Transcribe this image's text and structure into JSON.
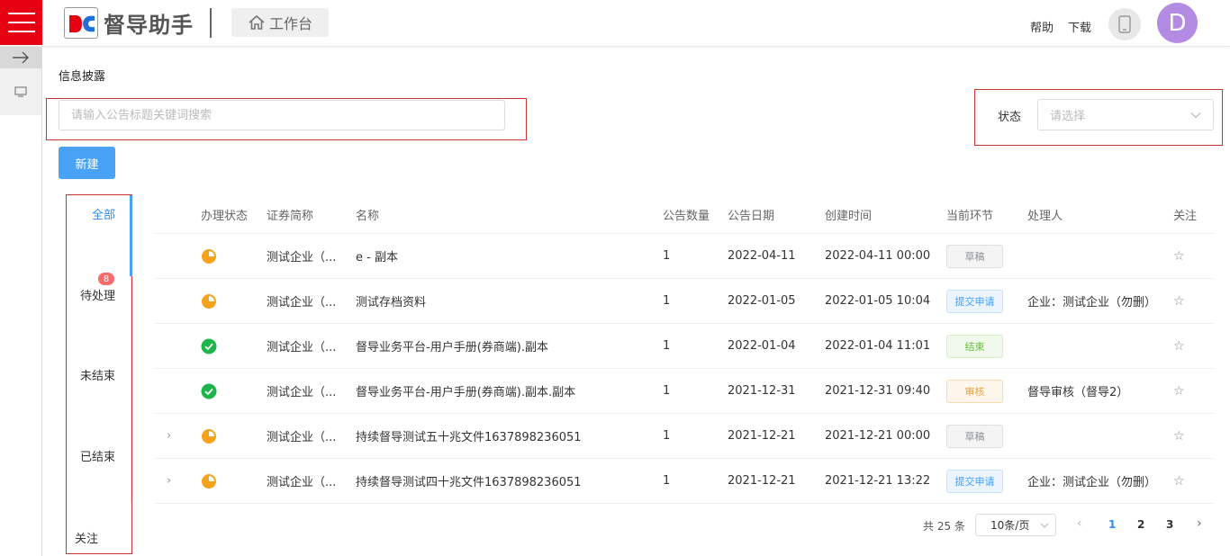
{
  "app": {
    "logo_text": "督导助手",
    "workbench_label": "工作台"
  },
  "header": {
    "help": "帮助",
    "download": "下载",
    "avatar_letter": "D"
  },
  "page": {
    "title": "信息披露"
  },
  "search": {
    "placeholder": "请输入公告标题关键词搜索",
    "value": ""
  },
  "status_filter": {
    "label": "状态",
    "placeholder": "请选择"
  },
  "actions": {
    "new_label": "新建"
  },
  "tabs": [
    {
      "label": "全部",
      "active": true
    },
    {
      "label": "待处理",
      "badge": "8"
    },
    {
      "label": "未结束"
    },
    {
      "label": "已结束"
    },
    {
      "label": "关注"
    }
  ],
  "table": {
    "columns": [
      "办理状态",
      "证券简称",
      "名称",
      "公告数量",
      "公告日期",
      "创建时间",
      "当前环节",
      "处理人",
      "关注"
    ],
    "rows": [
      {
        "status": "pending",
        "security": "测试企业（...",
        "name": "e - 副本",
        "count": "1",
        "date": "2022-04-11",
        "created": "2022-04-11 00:00",
        "node": "草稿",
        "node_type": "draft",
        "handler": "",
        "expandable": false
      },
      {
        "status": "pending",
        "security": "测试企业（...",
        "name": "测试存档资料",
        "count": "1",
        "date": "2022-01-05",
        "created": "2022-01-05 10:04",
        "node": "提交申请",
        "node_type": "submit",
        "handler": "企业：测试企业（勿删）",
        "expandable": false
      },
      {
        "status": "done",
        "security": "测试企业（...",
        "name": "督导业务平台-用户手册(券商端).副本",
        "count": "1",
        "date": "2022-01-04",
        "created": "2022-01-04 11:01",
        "node": "结束",
        "node_type": "done",
        "handler": "",
        "expandable": false
      },
      {
        "status": "done",
        "security": "测试企业（...",
        "name": "督导业务平台-用户手册(券商端).副本.副本",
        "count": "1",
        "date": "2021-12-31",
        "created": "2021-12-31 09:40",
        "node": "审核",
        "node_type": "review",
        "handler": "督导审核（督导2）",
        "expandable": false
      },
      {
        "status": "pending",
        "security": "测试企业（...",
        "name": "持续督导测试五十兆文件1637898236051",
        "count": "1",
        "date": "2021-12-21",
        "created": "2021-12-21 00:00",
        "node": "草稿",
        "node_type": "draft",
        "handler": "",
        "expandable": true
      },
      {
        "status": "pending",
        "security": "测试企业（...",
        "name": "持续督导测试四十兆文件1637898236051",
        "count": "1",
        "date": "2021-12-21",
        "created": "2021-12-21 13:22",
        "node": "提交申请",
        "node_type": "submit",
        "handler": "企业：测试企业（勿删）",
        "expandable": true
      }
    ]
  },
  "pagination": {
    "total": "共 25 条",
    "page_size": "10条/页",
    "pages": [
      "1",
      "2",
      "3"
    ],
    "current": "1"
  },
  "colors": {
    "brand_red": "#e60012",
    "primary": "#4aa2f7",
    "pending_orange": "#f7a21b",
    "done_green": "#1db54a"
  }
}
